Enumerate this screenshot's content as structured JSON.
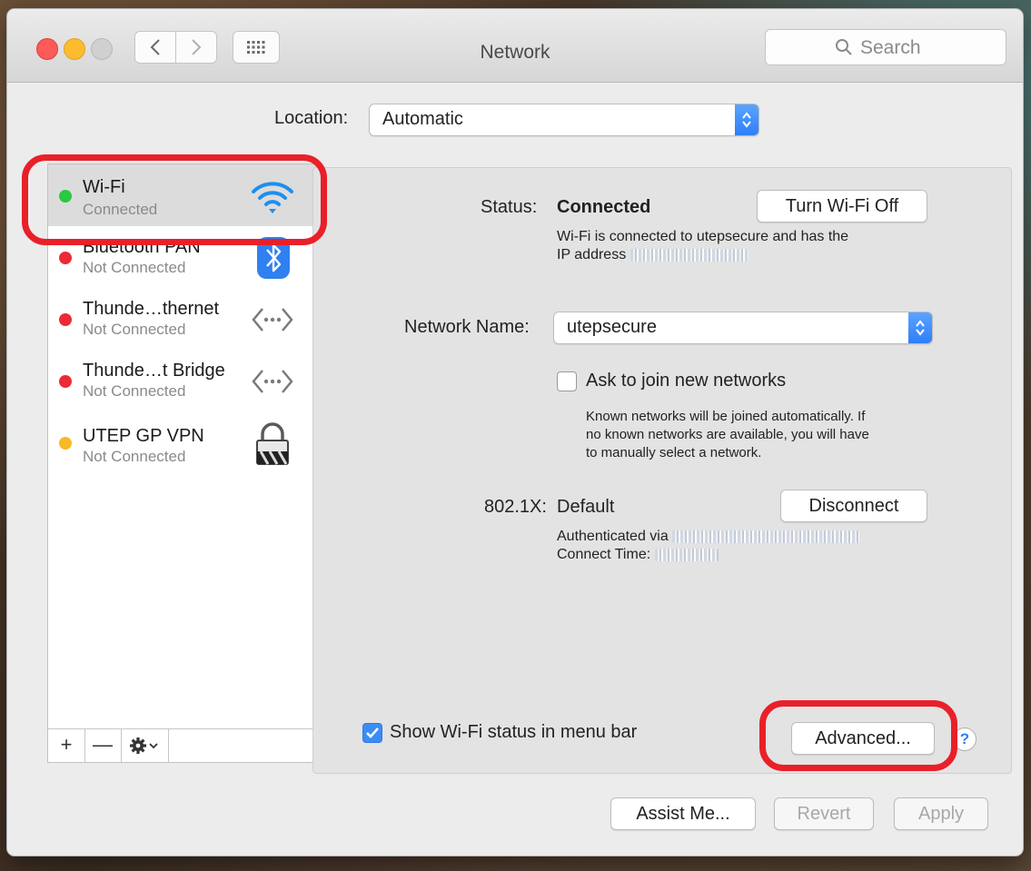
{
  "window": {
    "title": "Network",
    "search_placeholder": "Search"
  },
  "location": {
    "label": "Location:",
    "value": "Automatic"
  },
  "services": [
    {
      "name": "Wi-Fi",
      "status": "Connected",
      "status_color": "#29c940",
      "icon": "wifi-icon",
      "selected": true
    },
    {
      "name": "Bluetooth PAN",
      "status": "Not Connected",
      "status_color": "#ec2a35",
      "icon": "bluetooth-icon"
    },
    {
      "name": "Thunde…thernet",
      "status": "Not Connected",
      "status_color": "#ec2a35",
      "icon": "ethernet-arrows-icon"
    },
    {
      "name": "Thunde…t Bridge",
      "status": "Not Connected",
      "status_color": "#ec2a35",
      "icon": "ethernet-arrows-icon"
    },
    {
      "name": "UTEP GP VPN",
      "status": "Not Connected",
      "status_color": "#f7b928",
      "icon": "lock-icon"
    }
  ],
  "sidebar_toolbar": {
    "add": "+",
    "remove": "—"
  },
  "detail": {
    "status_label": "Status:",
    "status_value": "Connected",
    "toggle_button": "Turn Wi-Fi Off",
    "status_desc_line1": "Wi-Fi is connected to utepsecure and has the",
    "status_desc_line2": "IP address",
    "network_name_label": "Network Name:",
    "network_name_value": "utepsecure",
    "ask_join_label": "Ask to join new networks",
    "ask_join_checked": false,
    "ask_join_desc_line1": "Known networks will be joined automatically. If",
    "ask_join_desc_line2": "no known networks are available, you will have",
    "ask_join_desc_line3": "to manually select a network.",
    "dot1x_label": "802.1X:",
    "dot1x_value": "Default",
    "disconnect_button": "Disconnect",
    "auth_label": "Authenticated via",
    "connect_time_label": "Connect Time:",
    "show_status_label": "Show Wi-Fi status in menu bar",
    "show_status_checked": true,
    "advanced_button": "Advanced...",
    "help": "?"
  },
  "footer": {
    "assist": "Assist Me...",
    "revert": "Revert",
    "apply": "Apply"
  },
  "colors": {
    "accent": "#2f7ef6",
    "highlight": "#e8202a"
  }
}
